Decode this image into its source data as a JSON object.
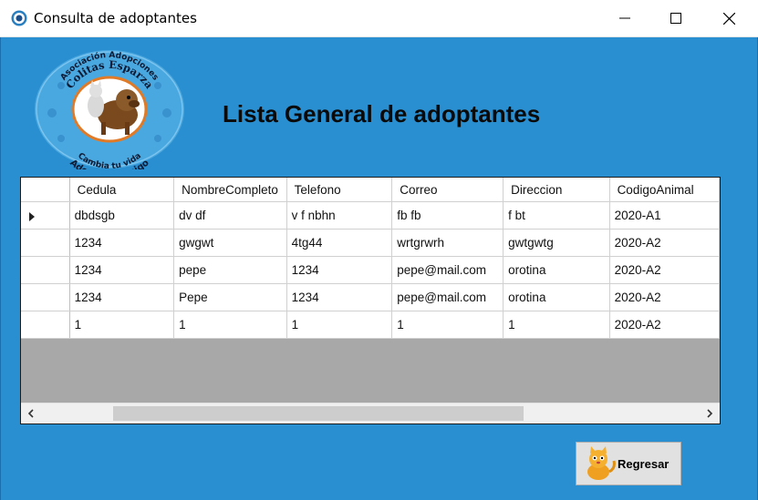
{
  "window": {
    "title": "Consulta de adoptantes"
  },
  "logo": {
    "top_text": "Asociación Adopciones",
    "name_text": "Colitas Esparza",
    "bottom_text_1": "Cambia tu vida",
    "bottom_text_2": "Adopta un amigo",
    "colors": {
      "ring": "#4aa8e0",
      "dark": "#0d1a33"
    }
  },
  "heading": "Lista General de adoptantes",
  "grid": {
    "columns": [
      "Cedula",
      "NombreCompleto",
      "Telefono",
      "Correo",
      "Direccion",
      "CodigoAnimal"
    ],
    "rows": [
      [
        "dbdsgb",
        "dv df",
        "v f nbhn",
        "fb fb",
        "f bt",
        "2020-A1"
      ],
      [
        "1234",
        "gwgwt",
        "4tg44",
        "wrtgrwrh",
        "gwtgwtg",
        "2020-A2"
      ],
      [
        "1234",
        "pepe",
        "1234",
        "pepe@mail.com",
        "orotina",
        "2020-A2"
      ],
      [
        "1234",
        "Pepe",
        "1234",
        "pepe@mail.com",
        "orotina",
        "2020-A2"
      ],
      [
        "1",
        "1",
        "1",
        "1",
        "1",
        "2020-A2"
      ]
    ],
    "selected_row": 0
  },
  "buttons": {
    "back_label": "Regresar",
    "minimize": "minimize-icon",
    "maximize": "maximize-icon",
    "close": "close-icon"
  },
  "colors": {
    "background": "#2a8fd0",
    "grid_empty": "#a8a8a8"
  }
}
